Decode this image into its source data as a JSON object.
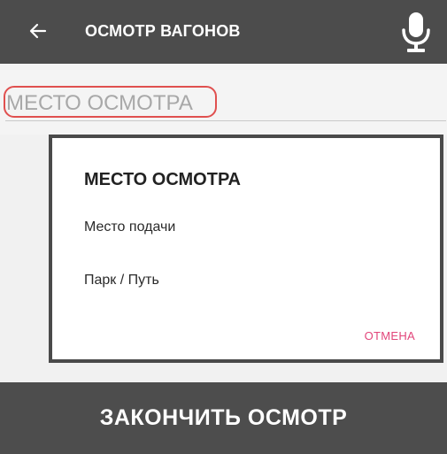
{
  "appbar": {
    "title": "ОСМОТР ВАГОНОВ",
    "back_icon": "arrow-left-icon",
    "mic_icon": "microphone-icon"
  },
  "field": {
    "placeholder": "МЕСТО ОСМОТРА",
    "value": ""
  },
  "dialog": {
    "title": "МЕСТО ОСМОТРА",
    "options": [
      {
        "label": "Место подачи"
      },
      {
        "label": "Парк / Путь"
      }
    ],
    "cancel_label": "ОТМЕНА"
  },
  "footer": {
    "action_label": "ЗАКОНЧИТЬ ОСМОТР"
  },
  "colors": {
    "appbar_bg": "#4c4c4c",
    "accent_pink": "#e2457a",
    "highlight_red": "#e0504f"
  }
}
